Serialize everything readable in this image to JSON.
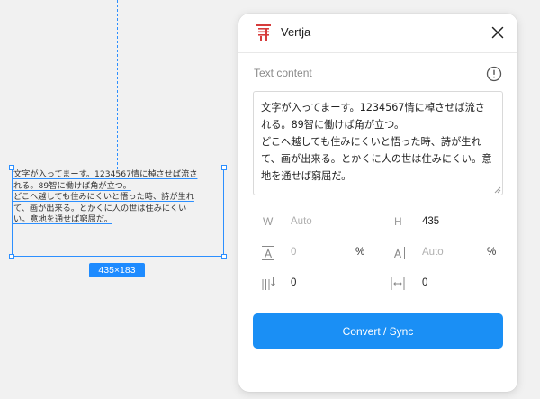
{
  "canvas": {
    "frame_lines": [
      "文字が入ってまーす。1234567情に棹させば流さ",
      "れる。89智に働けば角が立つ。",
      "どこへ越しても住みにくいと悟った時、詩が生れ",
      "て、画が出来る。とかくに人の世は住みにくい",
      "い。意地を通せば窮屈だ。"
    ],
    "size_badge": "435×183"
  },
  "panel": {
    "title": "Vertja",
    "logo_icon": "vertja-logo-icon",
    "close_icon": "close-icon",
    "section_label": "Text content",
    "info_icon": "info-icon",
    "text_value": "文字が入ってまーす。1234567情に棹させば流される。89智に働けば角が立つ。\nどこへ越しても住みにくいと悟った時、詩が生れて、画が出来る。とかくに人の世は住みにくい。意地を通せば窮屈だ。",
    "width_label": "W",
    "width_value": "Auto",
    "height_label": "H",
    "height_value": "435",
    "line_height_icon": "line-height-icon",
    "line_height_value": "0",
    "line_height_unit": "%",
    "letter_spacing_icon": "letter-spacing-icon",
    "letter_spacing_value": "Auto",
    "letter_spacing_unit": "%",
    "paragraph_spacing_icon": "paragraph-spacing-icon",
    "paragraph_spacing_value": "0",
    "indent_icon": "indent-icon",
    "indent_value": "0",
    "convert_button": "Convert / Sync"
  },
  "colors": {
    "accent": "#1a8ff5",
    "selection": "#2c8fff",
    "logo_red": "#d63b3b"
  }
}
